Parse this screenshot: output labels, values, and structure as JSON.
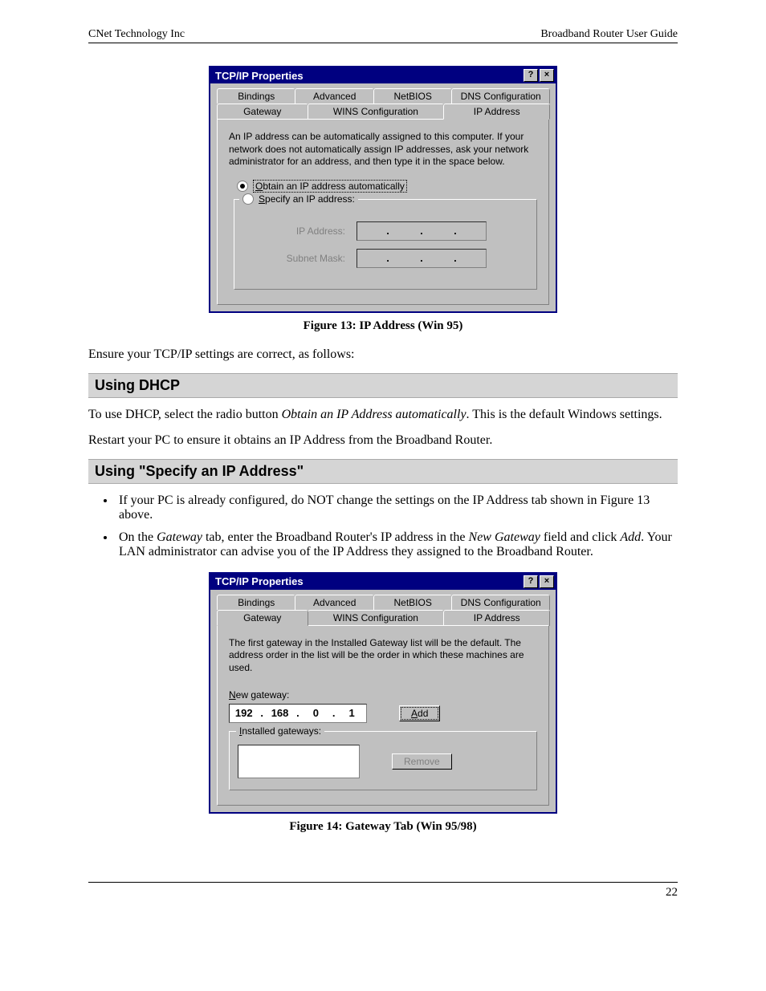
{
  "header": {
    "left": "CNet Technology Inc",
    "right": "Broadband Router User Guide"
  },
  "dialog1": {
    "title": "TCP/IP Properties",
    "help": "?",
    "close": "×",
    "tabs_row1": [
      "Bindings",
      "Advanced",
      "NetBIOS",
      "DNS Configuration"
    ],
    "tabs_row2": [
      "Gateway",
      "WINS Configuration",
      "IP Address"
    ],
    "panel_text": "An IP address can be automatically assigned to this computer. If your network does not automatically assign IP addresses, ask your network administrator for an address, and then type it in the space below.",
    "radio_obtain": "Obtain an IP address automatically",
    "radio_specify": "Specify an IP address:",
    "label_ip": "IP Address:",
    "label_subnet": "Subnet Mask:"
  },
  "caption1": "Figure 13: IP Address (Win 95)",
  "body1": "Ensure your TCP/IP settings are correct, as follows:",
  "heading1": "Using DHCP",
  "body2_pre": "To use DHCP, select the radio button ",
  "body2_italic": "Obtain an IP Address automatically",
  "body2_post": ". This is the default Windows settings.",
  "body3": "Restart your PC to ensure it obtains an IP Address from the Broadband Router.",
  "heading2": "Using \"Specify an IP Address\"",
  "bullet1": "If your PC is already configured, do NOT change the settings on the IP Address tab shown in Figure 13 above.",
  "bullet2_a": "On the ",
  "bullet2_b": "Gateway",
  "bullet2_c": " tab, enter the Broadband Router's IP address in the ",
  "bullet2_d": "New Gateway",
  "bullet2_e": " field and click ",
  "bullet2_f": "Add",
  "bullet2_g": ". Your LAN administrator can advise you of the IP Address they assigned to the Broadband Router.",
  "dialog2": {
    "title": "TCP/IP Properties",
    "help": "?",
    "close": "×",
    "tabs_row1": [
      "Bindings",
      "Advanced",
      "NetBIOS",
      "DNS Configuration"
    ],
    "tabs_row2": [
      "Gateway",
      "WINS Configuration",
      "IP Address"
    ],
    "panel_text": "The first gateway in the Installed Gateway list will be the default. The address order in the list will be the order in which these machines are used.",
    "new_gateway_label": "New gateway:",
    "ip_octets": [
      "192",
      "168",
      "0",
      "1"
    ],
    "add_btn": "Add",
    "installed_label": "Installed gateways:",
    "remove_btn": "Remove"
  },
  "caption2": "Figure 14: Gateway Tab (Win 95/98)",
  "page_number": "22"
}
